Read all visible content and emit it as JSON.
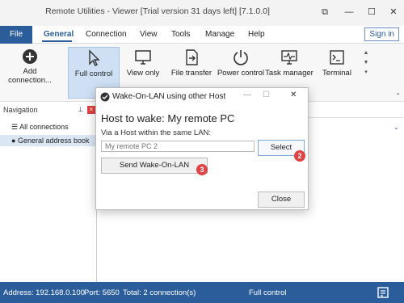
{
  "window": {
    "title": "Remote Utilities - Viewer [Trial version 31 days left] [7.1.0.0]"
  },
  "menu": {
    "file": "File",
    "items": [
      "General",
      "Connection",
      "View",
      "Tools",
      "Manage",
      "Help"
    ],
    "active": "General",
    "sign_in": "Sign in"
  },
  "ribbon": {
    "add_connection": "Add connection...",
    "buttons": [
      "Full control",
      "View only",
      "File transfer",
      "Power control",
      "Task manager",
      "Terminal"
    ],
    "selected": "Full control"
  },
  "navigation": {
    "header": "Navigation",
    "items": [
      "All connections",
      "General address book"
    ],
    "selected": "General address book"
  },
  "dialog": {
    "title": "Wake-On-LAN using other Host",
    "heading": "Host to wake: My remote PC",
    "via_label": "Via a Host within the same LAN:",
    "input_placeholder": "My remote PC 2",
    "select_label": "Select",
    "send_label": "Send Wake-On-LAN",
    "close_label": "Close",
    "badge_select": "2",
    "badge_send": "3"
  },
  "status": {
    "address": "Address: 192.168.0.100",
    "port": "Port: 5650",
    "total": "Total: 2 connection(s)",
    "mode": "Full control"
  },
  "colors": {
    "accent": "#2c5d9b",
    "badge": "#e04343",
    "selection": "#cfe0f5"
  }
}
